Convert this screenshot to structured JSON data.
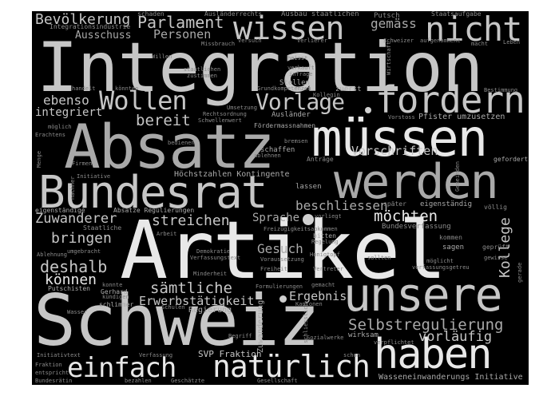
{
  "cloud": {
    "words": {
      "artikel": "Artikel",
      "schweiz": "Schweiz",
      "integration": "Integration",
      "absatz": "Absatz",
      "muessen": "müssen",
      "werden": "werden",
      "bundesrat": "Bundesrat",
      "unsere": "unsere",
      "haben": "haben",
      "fordern": "fordern",
      "nicht": "nicht",
      "wissen": "wissen",
      "wollen": "Wollen",
      "vorlage": "Vorlage",
      "einfach": "einfach",
      "natuerlich": "natürlich",
      "bevoelkerung": "Bevölkerung",
      "parlament": "Parlament",
      "ausschuss": "Ausschuss",
      "personen": "Personen",
      "gemaess": "gemäss",
      "ebenso": "ebenso",
      "integriert": "integriert",
      "bereit": "bereit",
      "selbstregulierung": "Selbstregulierung",
      "vorlaeufig": "vorläufig",
      "moechten": "möchten",
      "beschliessen": "beschliessen",
      "vorschriften": "Vorschriften",
      "zuwanderer": "Zuwanderer",
      "streichen": "streichen",
      "bringen": "bringen",
      "deshalb": "deshalb",
      "koennen": "können",
      "saemtliche": "sämtliche",
      "erwerbstaetigkeit": "Erwerbstätigkeit",
      "gesuch": "Gesuch",
      "ergebnis": "Ergebnis",
      "sprache": "Sprache",
      "kollege": "Kollege",
      "hoechstzahlen": "Höchstzahlen Kontingente",
      "svp_fraktion": "SVP Fraktion",
      "wasseneinwanderungs": "Wasseneinwanderungs Initiative",
      "bundesverfassung": "Bundesverfassung",
      "regierung": "Regierung",
      "zuwanderung": "Zuwanderung",
      "integrationsindustrie": "Integrationsindustrie",
      "schaden": "schaden",
      "auslaenderrechts": "Ausländerrechts",
      "ausbau_staatlichen": "Ausbau staatlichen",
      "putsch": "Putsch",
      "staatsaufgabe": "Staatsaufgabe",
      "versuch": "Versuch",
      "verlierer": "Verlierer",
      "schweizer": "Schweizer",
      "aufgenommene": "aufgenommene",
      "macht": "macht",
      "leben": "Leben",
      "missbrauch": "Missbrauch",
      "heisst": "heisst",
      "verkauft": "verkauft",
      "infrage": "infrage",
      "wirtschaft": "Wirtschaft",
      "willen": "Willen",
      "staatlichen_zustimmen": "staatlichen zustimmen",
      "stellen": "Stellen",
      "grundkompetenzen": "Grundkompetenzen",
      "zuerst": "zuerst",
      "handelt": "handelt",
      "koennten": "könnten",
      "kollegin": "Kollegin",
      "bestimmung": "Bestimmung",
      "rechtsordnung": "Rechtsordnung",
      "schwellenwert": "Schwellenwert",
      "umsetzung": "Umsetzung",
      "auslaender": "Ausländer",
      "vorstoss": "Vorstoss",
      "pfister_umzusetzen": "Pfister umzusetzen",
      "moeglich": "möglich",
      "erachtens": "Erachtens",
      "foerdermassnahmen": "Fördermassnahmen",
      "bedienen": "bedienen",
      "bremsen": "bremsen",
      "schaffen": "schaffen",
      "ablehnen": "ablehnen",
      "antraege": "Anträge",
      "gefordert": "gefordert",
      "menge": "Menge",
      "firmen": "Firmen",
      "initiative": "Initiative",
      "gemeinden": "Gemeinden",
      "lassen": "lassen",
      "nachher": "nachher",
      "eigenstaendige": "eigenständige",
      "absaetze_regulierungen": "Absätze Regulierungen",
      "spaeter": "später",
      "eigenstaendig": "eigenständig",
      "voellig": "völlig",
      "vorliegt": "vorliegt",
      "staatliche": "Staatliche",
      "arbeit": "Arbeit",
      "freizuegigkeitsabkommen": "Freizügigkeitsabkommen",
      "bitten": "bitten",
      "regelung": "Regelung",
      "kommen": "kommen",
      "sagen": "sagen",
      "geprueft": "geprüft",
      "gewisse": "gewisse",
      "gerade": "gerade",
      "ablehnung": "Ablehnung",
      "umgebracht": "umgebracht",
      "demokratie": "Demokratie",
      "verfassungstext": "Verfassungstext",
      "voraussetzung": "Voraussetzung",
      "honigtopf": "Honigtopf",
      "sollten": "sollten",
      "moeglicht_verfassungsgetreu": "möglicht verfassungsgetreu",
      "minderheit": "Minderheit",
      "freiheit": "Freiheit",
      "vertreter": "Vertreter",
      "konnte": "konnte",
      "kuendigen": "kündigen",
      "putschisten": "Putschisten",
      "gerhard": "Gerhard",
      "formulierungen": "Formulierungen",
      "gemacht": "gemacht",
      "kantonen": "Kantonen",
      "schlimmer": "schlimmer",
      "wasser": "Wasser",
      "schulen": "Schulen",
      "begriff": "Begriff",
      "schliesslich": "schliesslich",
      "sozialwerke": "Sozialwerke",
      "wirksam": "wirksam",
      "verpflichtet": "verpflichtet",
      "initiativtext": "Initiativtext",
      "verfassung": "Verfassung",
      "schon": "schon",
      "fraktion": "Fraktion",
      "entspricht": "entspricht",
      "bundesraetin": "Bundesrätin",
      "bezahlen": "bezahlen",
      "geschaetzte": "Geschätzte",
      "gesellschaft": "Gesellschaft"
    }
  }
}
